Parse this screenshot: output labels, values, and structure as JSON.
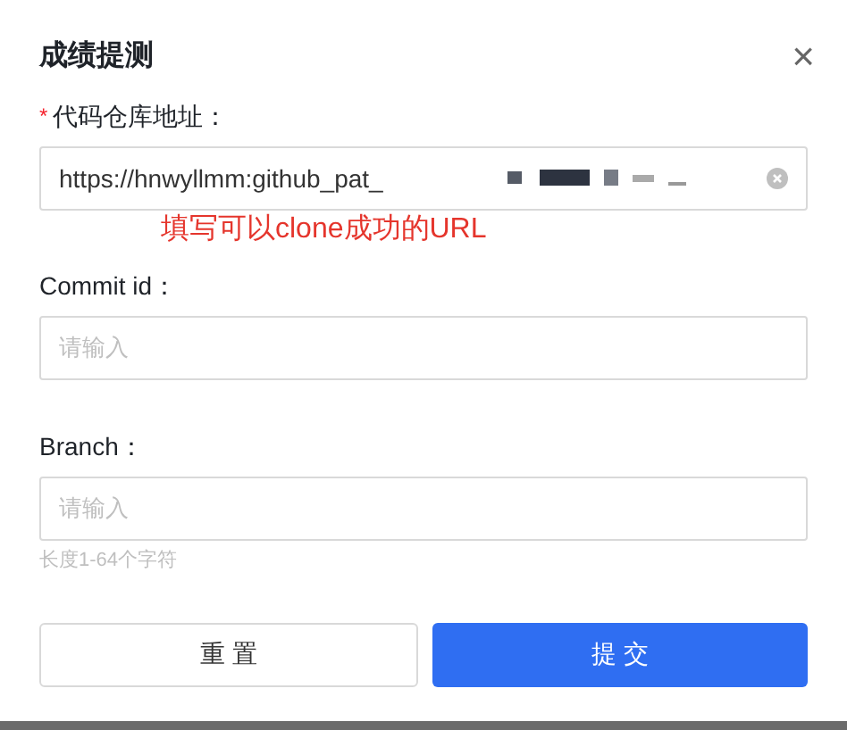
{
  "dialog": {
    "title": "成绩提测",
    "close": "×"
  },
  "fields": [
    {
      "label": "代码仓库地址：",
      "required_mark": "*",
      "value": "https://hnwyllmm:github_pat_",
      "redacted": true,
      "clearable": true,
      "annotation": "填写可以clone成功的URL"
    },
    {
      "label": "Commit id：",
      "placeholder": "请输入"
    },
    {
      "label": "Branch：",
      "placeholder": "请输入",
      "help": "长度1-64个字符"
    }
  ],
  "buttons": [
    {
      "label": "重 置",
      "kind": "default"
    },
    {
      "label": "提 交",
      "kind": "primary"
    }
  ]
}
